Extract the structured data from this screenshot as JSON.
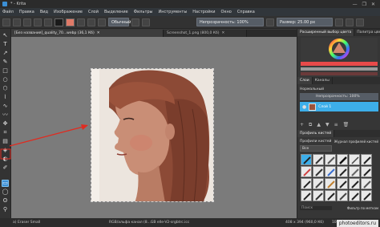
{
  "window": {
    "title": "* - Krita",
    "controls": [
      "—",
      "❐",
      "✕"
    ]
  },
  "menu": [
    "Файл",
    "Правка",
    "Вид",
    "Изображение",
    "Слой",
    "Выделение",
    "Фильтры",
    "Инструменты",
    "Настройки",
    "Окно",
    "Справка"
  ],
  "toolbar": {
    "opacity_label": "Непрозрачность: 100%",
    "size_label": "Размер: 25.00 px",
    "blend_mode": "Обычный",
    "fg_color": "#1a1a1a",
    "bg_color": "#e07a68"
  },
  "tabs": [
    {
      "label": "[Без названия]_quality_70...webp (36,1 Кб)",
      "active": true
    },
    {
      "label": "Screenshot_1.png (800,0 Кб)",
      "active": false
    }
  ],
  "dock": {
    "color_tabs": [
      "Расширенный выбор цвета",
      "Палитра цве..."
    ],
    "layers_tabs": [
      "Слои",
      "Каналы"
    ],
    "layer_blend": "Нормальный",
    "layer_opacity": "Непрозрачность: 100%",
    "layer_name": "Слой 1",
    "brush_tabs": [
      "Профиль кистей"
    ],
    "brush_presets_title": "Профили кистей",
    "brush_tag": "Все",
    "brush_tag_label": "Журнал профилей кистей",
    "brush_search_placeholder": "Поиск",
    "brush_filter_label": "Фильтр по меткам"
  },
  "status": {
    "brush": "a) Eraser Small",
    "color_info": "RGB/альфа канал (8...GB elle-V2-srgbtrc.icc",
    "size_info": "408 x 394 (960,0 Кб)",
    "zoom": "100%"
  },
  "watermark": "photoeditors.ru",
  "colors": {
    "accent": "#3daee9",
    "selected_tool": "#3b8fd6",
    "arrow": "#e02b20"
  }
}
